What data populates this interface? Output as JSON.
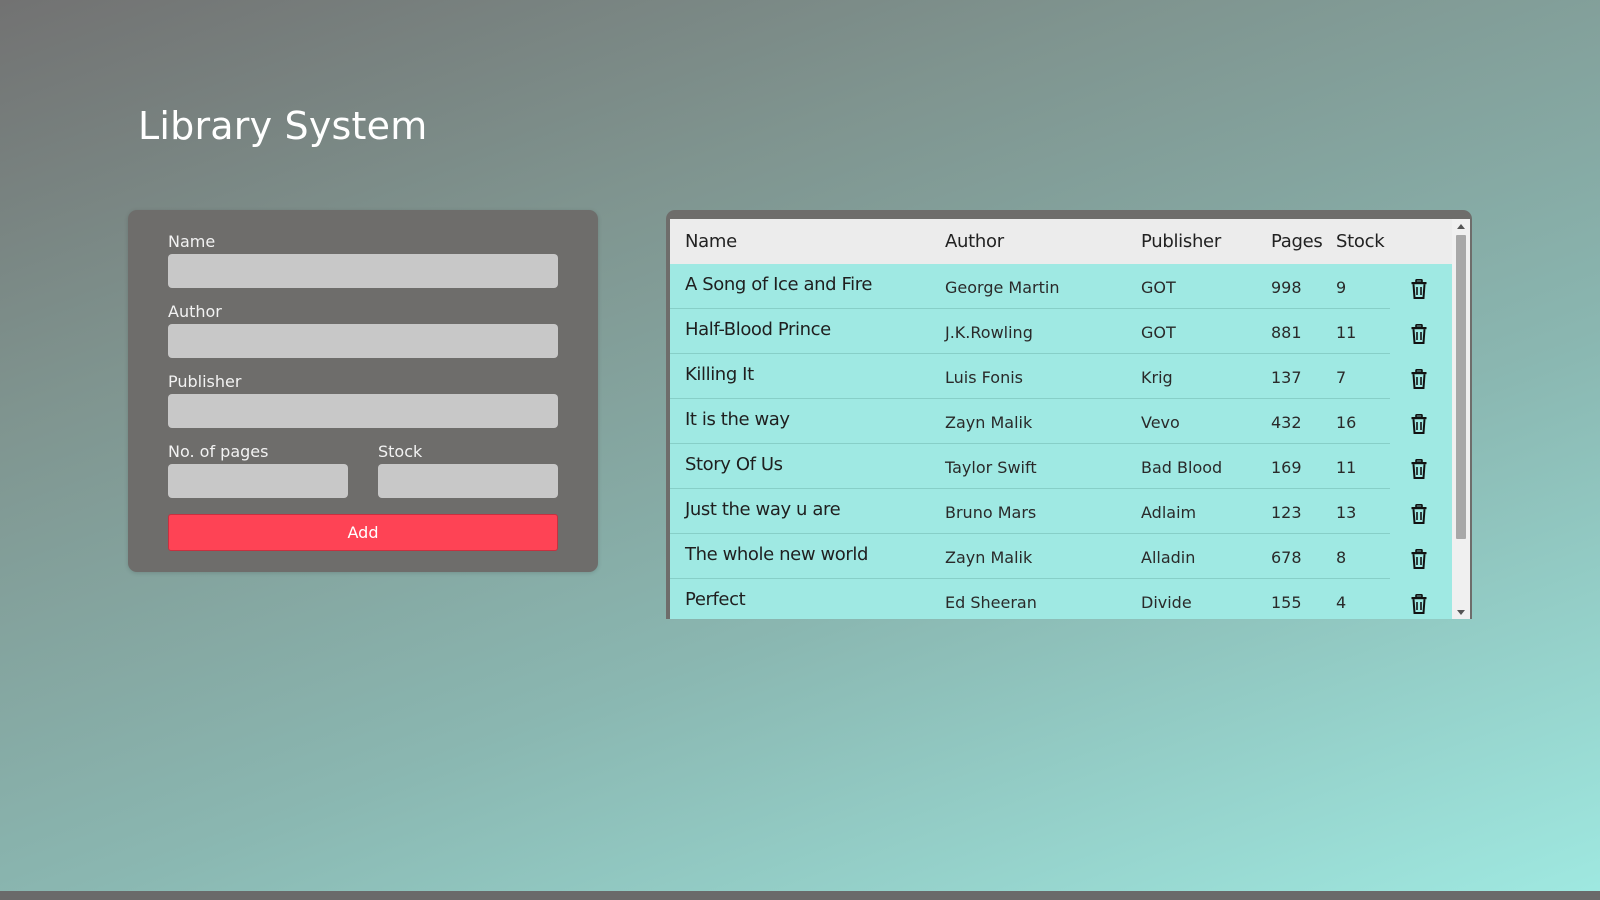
{
  "title": "Library System",
  "form": {
    "name_label": "Name",
    "name_value": "",
    "author_label": "Author",
    "author_value": "",
    "publisher_label": "Publisher",
    "publisher_value": "",
    "pages_label": "No. of pages",
    "pages_value": "",
    "stock_label": "Stock",
    "stock_value": "",
    "add_label": "Add"
  },
  "table": {
    "headers": {
      "name": "Name",
      "author": "Author",
      "publisher": "Publisher",
      "pages": "Pages",
      "stock": "Stock"
    },
    "rows": [
      {
        "name": "A Song of Ice and Fire",
        "author": "George Martin",
        "publisher": "GOT",
        "pages": "998",
        "stock": "9"
      },
      {
        "name": "Half-Blood Prince",
        "author": "J.K.Rowling",
        "publisher": "GOT",
        "pages": "881",
        "stock": "11"
      },
      {
        "name": "Killing It",
        "author": "Luis Fonis",
        "publisher": "Krig",
        "pages": "137",
        "stock": "7"
      },
      {
        "name": "It is the way",
        "author": "Zayn Malik",
        "publisher": "Vevo",
        "pages": "432",
        "stock": "16"
      },
      {
        "name": "Story Of Us",
        "author": "Taylor Swift",
        "publisher": "Bad Blood",
        "pages": "169",
        "stock": "11"
      },
      {
        "name": "Just the way u are",
        "author": "Bruno Mars",
        "publisher": "Adlaim",
        "pages": "123",
        "stock": "13"
      },
      {
        "name": "The whole new world",
        "author": "Zayn Malik",
        "publisher": "Alladin",
        "pages": "678",
        "stock": "8"
      },
      {
        "name": "Perfect",
        "author": "Ed Sheeran",
        "publisher": "Divide",
        "pages": "155",
        "stock": "4"
      }
    ],
    "row_action_icon": "trash-icon"
  },
  "colors": {
    "panel": "#6e6d6b",
    "input": "#c8c8c8",
    "add_button": "#fe4355",
    "row_background": "#9fe9e3",
    "header_background": "#ececec"
  }
}
